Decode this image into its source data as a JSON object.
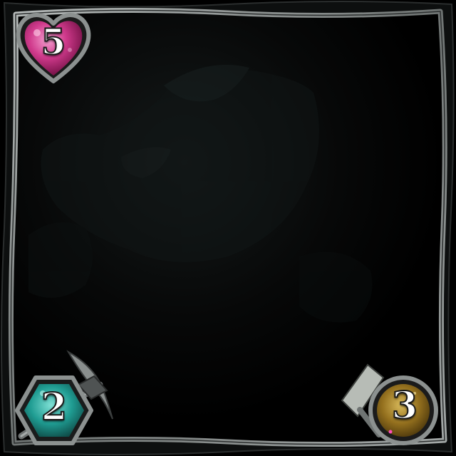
{
  "card": {
    "health": "5",
    "attack": "2",
    "durability": "3"
  },
  "colors": {
    "background": "#000000",
    "frame": "#8e9392",
    "health_gem": "#c2267a",
    "attack_gem": "#1e9a92",
    "durability_gem": "#9a7a22"
  },
  "icons": {
    "health": "heart-icon",
    "attack": "pickaxe-icon",
    "durability": "shovel-icon"
  }
}
